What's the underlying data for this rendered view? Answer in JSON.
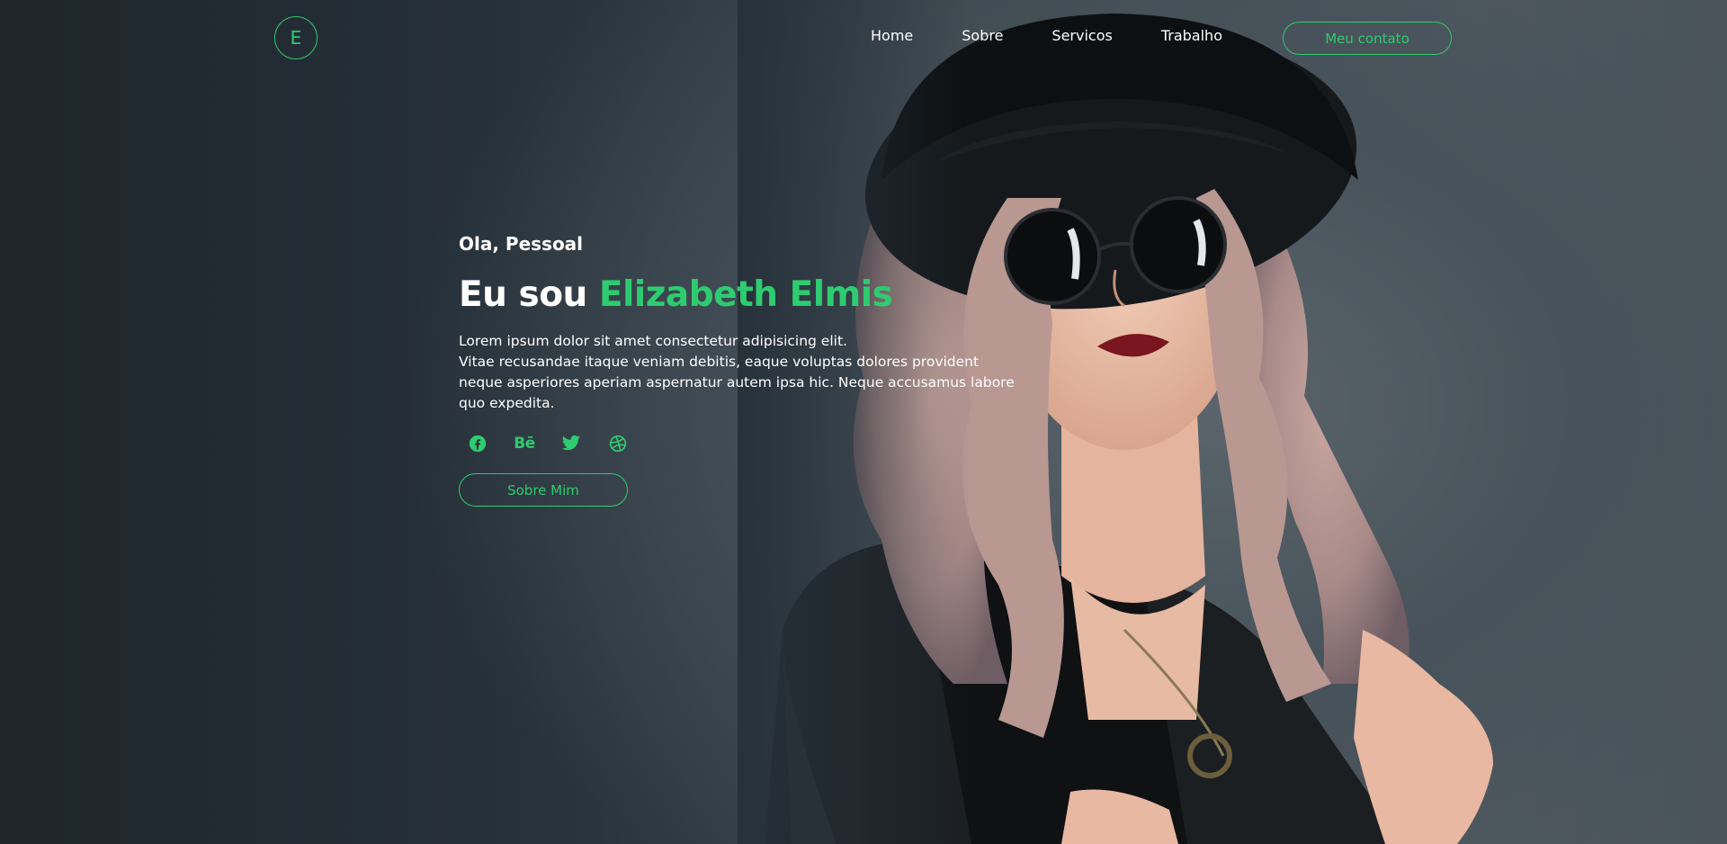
{
  "header": {
    "logo_letter": "E",
    "nav": [
      {
        "label": "Home"
      },
      {
        "label": "Sobre"
      },
      {
        "label": "Servicos"
      },
      {
        "label": "Trabalho"
      }
    ],
    "contact_label": "Meu contato"
  },
  "intro": {
    "greeting": "Ola, Pessoal",
    "headline_prefix": "Eu sou",
    "headline_name": "Elizabeth Elmis",
    "description_lines": [
      "Lorem ipsum dolor sit amet consectetur adipisicing elit.",
      "Vitae recusandae itaque veniam debitis, eaque voluptas dolores provident neque asperiores aperiam aspernatur autem ipsa hic. Neque accusamus labore quo expedita."
    ],
    "socials": [
      {
        "icon": "facebook-icon"
      },
      {
        "icon": "behance-icon",
        "glyph": "Bē"
      },
      {
        "icon": "twitter-icon"
      },
      {
        "icon": "dribbble-icon"
      }
    ],
    "about_label": "Sobre Mim"
  },
  "colors": {
    "accent": "#2ecc71",
    "background": "#2b3338",
    "text": "#ffffff"
  }
}
